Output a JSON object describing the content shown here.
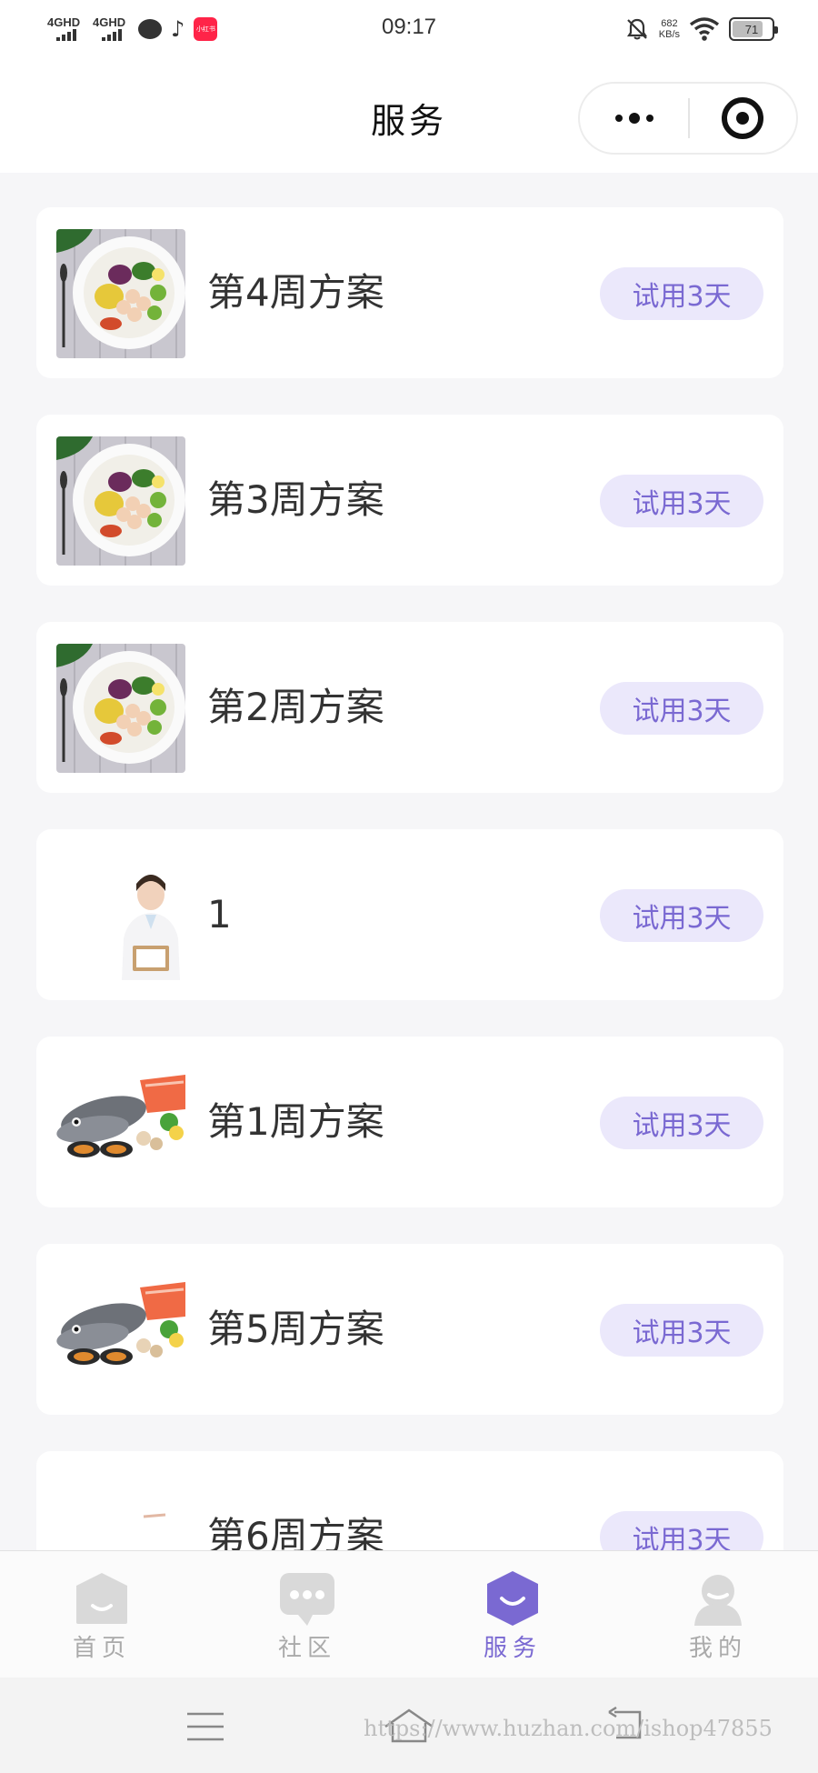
{
  "status_bar": {
    "signal_1": "4GHD",
    "signal_2": "4GHD",
    "red_app_label": "小红书",
    "time": "09:17",
    "speed_value": "682",
    "speed_unit": "KB/s",
    "battery": "71"
  },
  "nav": {
    "title": "服务"
  },
  "cards": [
    {
      "title": "第4周方案",
      "button": "试用3天",
      "thumb": "salad-plate"
    },
    {
      "title": "第3周方案",
      "button": "试用3天",
      "thumb": "salad-plate"
    },
    {
      "title": "第2周方案",
      "button": "试用3天",
      "thumb": "salad-plate"
    },
    {
      "title": "1",
      "button": "试用3天",
      "thumb": "doctor-photo"
    },
    {
      "title": "第1周方案",
      "button": "试用3天",
      "thumb": "seafood-photo"
    },
    {
      "title": "第5周方案",
      "button": "试用3天",
      "thumb": "seafood-photo"
    },
    {
      "title": "第6周方案",
      "button": "试用3天",
      "thumb": "blank-photo"
    }
  ],
  "tabs": [
    {
      "label": "首页",
      "icon": "home-icon"
    },
    {
      "label": "社区",
      "icon": "chat-icon"
    },
    {
      "label": "服务",
      "icon": "service-icon",
      "active": true
    },
    {
      "label": "我的",
      "icon": "profile-icon"
    }
  ],
  "colors": {
    "accent": "#7a69d2",
    "accent_bg": "#ebe8fb",
    "page_bg": "#f6f6f8",
    "inactive": "#d9d9d9"
  },
  "watermark": "https://www.huzhan.com/ishop47855"
}
